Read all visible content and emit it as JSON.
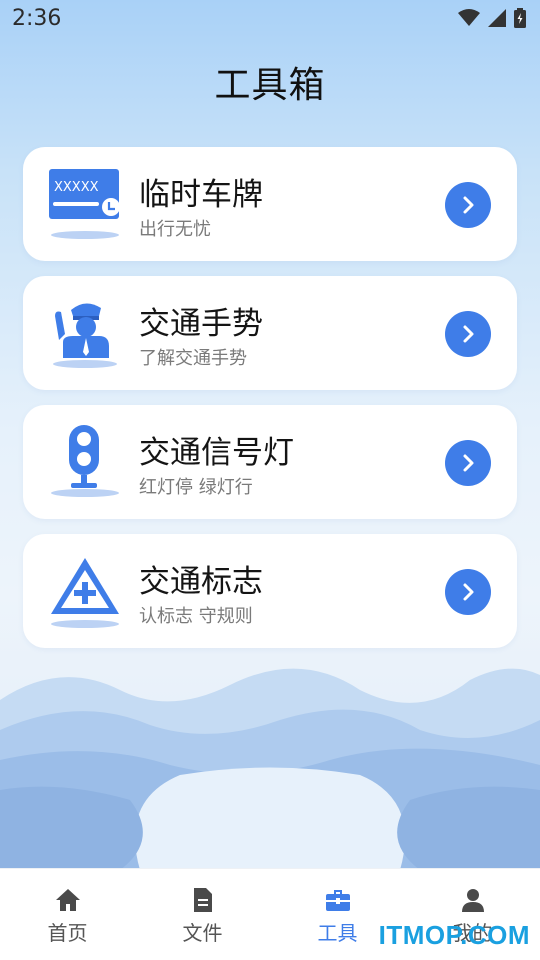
{
  "status_bar": {
    "time": "2:36"
  },
  "page": {
    "title": "工具箱"
  },
  "tools": [
    {
      "title": "临时车牌",
      "subtitle": "出行无忧",
      "icon": "temp-plate-icon",
      "plate_text": "XXXXX"
    },
    {
      "title": "交通手势",
      "subtitle": "了解交通手势",
      "icon": "traffic-police-icon"
    },
    {
      "title": "交通信号灯",
      "subtitle": "红灯停 绿灯行",
      "icon": "traffic-light-icon"
    },
    {
      "title": "交通标志",
      "subtitle": "认标志 守规则",
      "icon": "traffic-sign-icon"
    }
  ],
  "tab_bar": {
    "items": [
      {
        "label": "首页",
        "icon": "home-icon",
        "active": false
      },
      {
        "label": "文件",
        "icon": "file-icon",
        "active": false
      },
      {
        "label": "工具",
        "icon": "toolbox-icon",
        "active": true
      },
      {
        "label": "我的",
        "icon": "user-icon",
        "active": false
      }
    ]
  },
  "watermark": "ITMOP.COM",
  "colors": {
    "accent": "#3f7de8",
    "card_bg": "#ffffff",
    "page_top": "#a9d1f7"
  }
}
